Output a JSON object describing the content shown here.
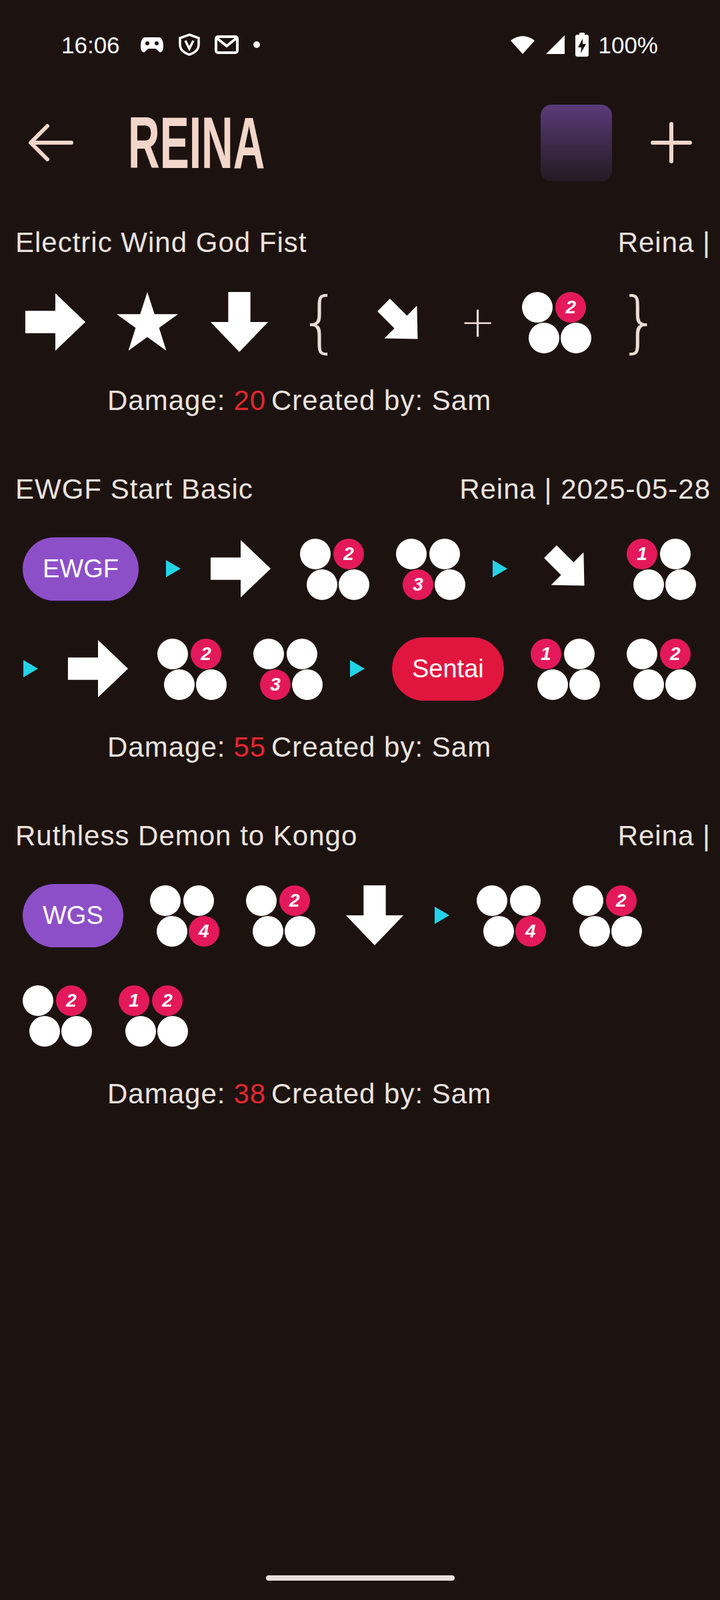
{
  "status_bar": {
    "time": "16:06",
    "battery": {
      "text": "100%",
      "level": 1,
      "charging": true
    }
  },
  "header": {
    "title": "REINA"
  },
  "combos": [
    {
      "name": "Electric Wind God Fist",
      "meta": "Reina |",
      "damage_label": "Damage:",
      "damage": "20",
      "creator": "Created by: Sam",
      "inputs": [
        {
          "kind": "direction",
          "direction": "f"
        },
        {
          "kind": "star"
        },
        {
          "kind": "direction",
          "direction": "d"
        },
        {
          "kind": "brace",
          "text": "{"
        },
        {
          "kind": "direction",
          "direction": "df"
        },
        {
          "kind": "operator",
          "text": "+"
        },
        {
          "kind": "button",
          "buttons": [
            "2"
          ]
        },
        {
          "kind": "brace",
          "text": "}"
        }
      ]
    },
    {
      "name": "EWGF Start Basic",
      "meta": "Reina | 2025-05-28",
      "damage_label": "Damage:",
      "damage": "55",
      "creator": "Created by: Sam",
      "inputs": [
        {
          "kind": "pill",
          "text": "EWGF",
          "color": "#8d4fc8"
        },
        {
          "kind": "separator"
        },
        {
          "kind": "direction",
          "direction": "f"
        },
        {
          "kind": "button",
          "buttons": [
            "2"
          ]
        },
        {
          "kind": "button",
          "buttons": [
            "3"
          ]
        },
        {
          "kind": "separator"
        },
        {
          "kind": "direction",
          "direction": "df"
        },
        {
          "kind": "button",
          "buttons": [
            "1"
          ]
        },
        {
          "kind": "separator"
        },
        {
          "kind": "direction",
          "direction": "f"
        },
        {
          "kind": "button",
          "buttons": [
            "2"
          ]
        },
        {
          "kind": "button",
          "buttons": [
            "3"
          ]
        },
        {
          "kind": "separator"
        },
        {
          "kind": "pill",
          "text": "Sentai",
          "color": "#e0163e"
        },
        {
          "kind": "button",
          "buttons": [
            "1"
          ]
        },
        {
          "kind": "button",
          "buttons": [
            "2"
          ]
        }
      ]
    },
    {
      "name": "Ruthless Demon to Kongo",
      "meta": "Reina |",
      "damage_label": "Damage:",
      "damage": "38",
      "creator": "Created by: Sam",
      "inputs": [
        {
          "kind": "pill",
          "text": "WGS",
          "color": "#8d4fc8"
        },
        {
          "kind": "button",
          "buttons": [
            "4"
          ]
        },
        {
          "kind": "button",
          "buttons": [
            "2"
          ]
        },
        {
          "kind": "direction",
          "direction": "d"
        },
        {
          "kind": "separator"
        },
        {
          "kind": "button",
          "buttons": [
            "4"
          ]
        },
        {
          "kind": "button",
          "buttons": [
            "2"
          ]
        },
        {
          "kind": "button",
          "buttons": [
            "2"
          ]
        },
        {
          "kind": "button",
          "buttons": [
            "1",
            "2"
          ]
        }
      ]
    }
  ]
}
